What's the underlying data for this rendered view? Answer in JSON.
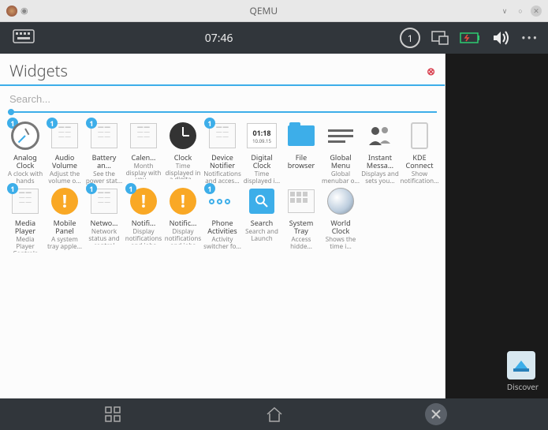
{
  "window": {
    "title": "QEMU"
  },
  "topbar": {
    "time": "07:46",
    "badge": "1"
  },
  "panel": {
    "title": "Widgets",
    "search_placeholder": "Search..."
  },
  "widgets": [
    {
      "name": "Analog Clock",
      "desc": "A clock with hands",
      "badge": true,
      "icon": "analog"
    },
    {
      "name": "Audio Volume",
      "desc": "Adjust the volume o...",
      "badge": true,
      "icon": "sheet"
    },
    {
      "name": "Battery an...",
      "desc": "See the power stat...",
      "badge": true,
      "icon": "sheet"
    },
    {
      "name": "Calen...",
      "desc": "Month display with you...",
      "badge": false,
      "icon": "sheet"
    },
    {
      "name": "Clock",
      "desc": "Time displayed in a digita...",
      "badge": false,
      "icon": "clock-dark"
    },
    {
      "name": "Device Notifier",
      "desc": "Notifications and acces...",
      "badge": true,
      "icon": "sheet"
    },
    {
      "name": "Digital Clock",
      "desc": "Time displayed i...",
      "badge": false,
      "icon": "digital",
      "text1": "01:18",
      "text2": "10.09.15"
    },
    {
      "name": "File browser",
      "desc": "",
      "badge": false,
      "icon": "folder"
    },
    {
      "name": "Global Menu",
      "desc": "Global menubar o...",
      "badge": false,
      "icon": "lines"
    },
    {
      "name": "Instant Messa...",
      "desc": "Displays and sets you...",
      "badge": false,
      "icon": "people"
    },
    {
      "name": "KDE Connect",
      "desc": "Show notification...",
      "badge": false,
      "icon": "phone"
    },
    {
      "name": "Media Player",
      "desc": "Media Player Controls",
      "badge": true,
      "icon": "sheet"
    },
    {
      "name": "Mobile Panel",
      "desc": "A system tray apple...",
      "badge": false,
      "icon": "excl"
    },
    {
      "name": "Netwo...",
      "desc": "Network status and control",
      "badge": true,
      "icon": "sheet"
    },
    {
      "name": "Notifi...",
      "desc": "Display notifications and jobs",
      "badge": true,
      "icon": "excl"
    },
    {
      "name": "Notific...",
      "desc": "Display notifications and jobs",
      "badge": false,
      "icon": "excl"
    },
    {
      "name": "Phone Activities",
      "desc": "Activity switcher fo...",
      "badge": true,
      "icon": "dots"
    },
    {
      "name": "Search",
      "desc": "Search and Launch",
      "badge": false,
      "icon": "search"
    },
    {
      "name": "System Tray",
      "desc": "Access hidde...",
      "badge": false,
      "icon": "tray"
    },
    {
      "name": "World Clock",
      "desc": "Shows the time i...",
      "badge": false,
      "icon": "world"
    }
  ],
  "desktop": {
    "discover": "Discover"
  }
}
